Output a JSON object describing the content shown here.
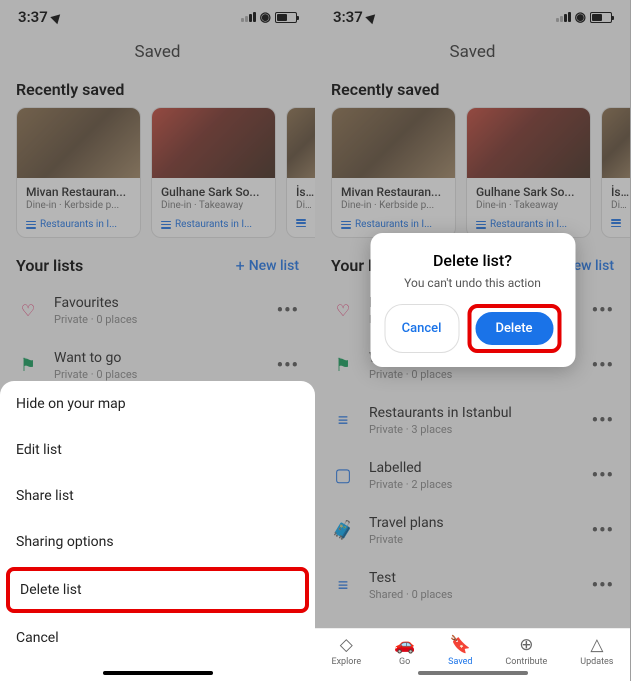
{
  "status": {
    "time": "3:37"
  },
  "page_title": "Saved",
  "recently_saved": {
    "header": "Recently saved",
    "cards": [
      {
        "title": "Mivan Restauran...",
        "sub": "Dine-in · Kerbside p...",
        "tag": "Restaurants in I..."
      },
      {
        "title": "Gulhane Sark So...",
        "sub": "Dine-in · Takeaway",
        "tag": "Restaurants in I..."
      },
      {
        "title": "İstan",
        "sub": "Dine-",
        "tag": "Res"
      }
    ]
  },
  "your_lists": {
    "header": "Your lists",
    "new_list": "New list",
    "items": [
      {
        "title": "Favourites",
        "sub": "Private · 0 places"
      },
      {
        "title": "Want to go",
        "sub": "Private · 0 places"
      },
      {
        "title": "Restaurants in Istanbul",
        "sub": "Private · 3 places"
      },
      {
        "title": "Labelled",
        "sub": "Private · 2 places"
      },
      {
        "title": "Travel plans",
        "sub": "Private"
      },
      {
        "title": "Test",
        "sub": "Shared · 0 places"
      }
    ]
  },
  "sheet": {
    "hide": "Hide on your map",
    "edit": "Edit list",
    "share": "Share list",
    "sharing_options": "Sharing options",
    "delete": "Delete list",
    "cancel": "Cancel"
  },
  "dialog": {
    "title": "Delete list?",
    "message": "You can't undo this action",
    "cancel": "Cancel",
    "delete": "Delete"
  },
  "nav": {
    "explore": "Explore",
    "go": "Go",
    "saved": "Saved",
    "contribute": "Contribute",
    "updates": "Updates"
  }
}
